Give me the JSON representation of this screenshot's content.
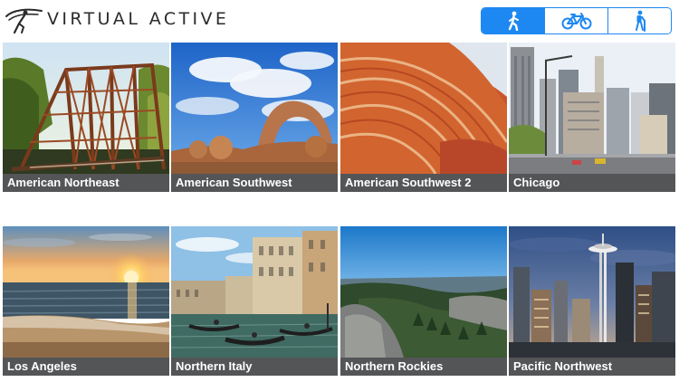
{
  "brand": {
    "name": "VIRTUAL ACTIVE",
    "logo_icon": "running-figure-logo-icon"
  },
  "mode_toggle": {
    "accent": "#1d88f2",
    "selected": "walk",
    "options": [
      {
        "id": "walk",
        "icon": "walker-icon"
      },
      {
        "id": "bike",
        "icon": "bicycle-icon"
      },
      {
        "id": "hike",
        "icon": "hiker-icon"
      }
    ]
  },
  "destinations": [
    {
      "label": "American Northeast",
      "scene": "railroad-bridge-in-forest"
    },
    {
      "label": "American Southwest",
      "scene": "natural-stone-arch"
    },
    {
      "label": "American Southwest 2",
      "scene": "red-sandstone-wave"
    },
    {
      "label": "Chicago",
      "scene": "city-street-with-skyscrapers"
    },
    {
      "label": "Los Angeles",
      "scene": "sunset-over-ocean-beach"
    },
    {
      "label": "Northern Italy",
      "scene": "venice-canal-with-gondolas"
    },
    {
      "label": "Northern Rockies",
      "scene": "forested-rocky-valley"
    },
    {
      "label": "Pacific Northwest",
      "scene": "seattle-skyline-space-needle"
    }
  ],
  "colors": {
    "caption_bg": "#545557",
    "caption_text": "#ffffff"
  }
}
